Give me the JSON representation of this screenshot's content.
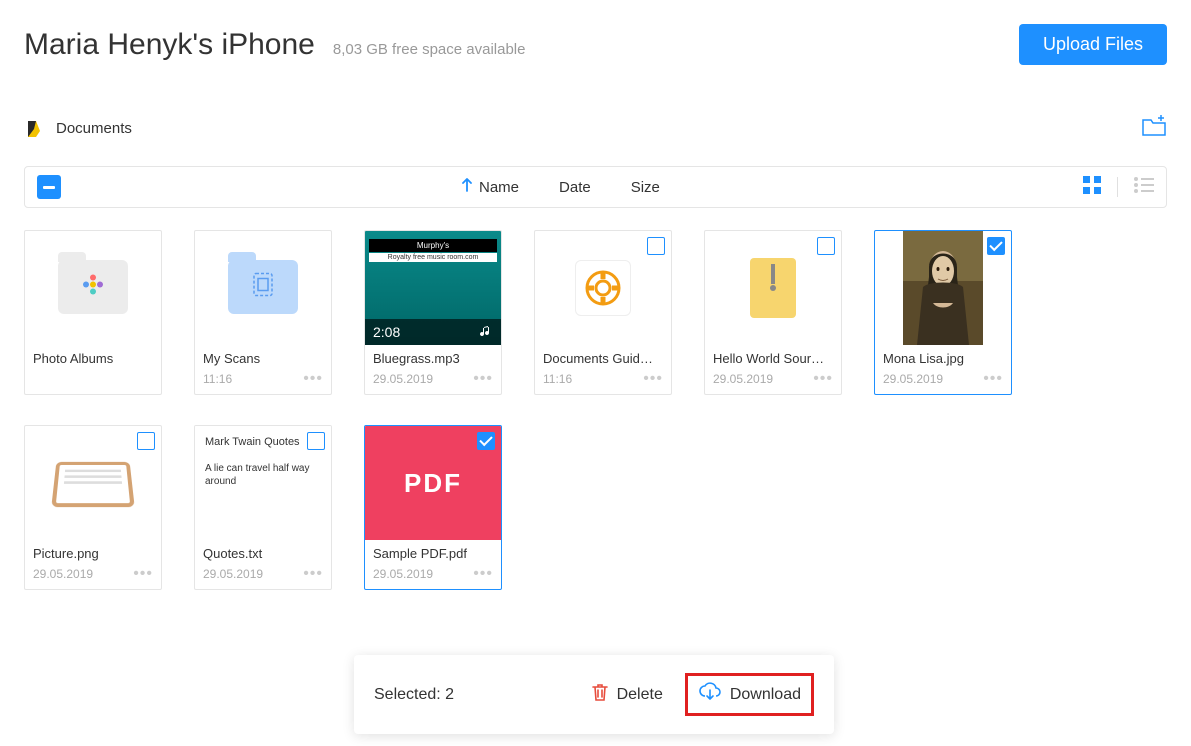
{
  "header": {
    "device_title": "Maria Henyk's iPhone",
    "free_space": "8,03 GB free space available",
    "upload_label": "Upload Files"
  },
  "breadcrumb": {
    "label": "Documents"
  },
  "toolbar": {
    "sort_columns": {
      "name": "Name",
      "date": "Date",
      "size": "Size"
    }
  },
  "files": [
    {
      "name": "Photo Albums",
      "date": "",
      "type": "folder-albums",
      "selected": false,
      "checkbox": false
    },
    {
      "name": "My Scans",
      "date": "11:16",
      "type": "folder-scans",
      "selected": false,
      "checkbox": false
    },
    {
      "name": "Bluegrass.mp3",
      "date": "29.05.2019",
      "type": "mp3",
      "selected": false,
      "checkbox": false,
      "mp3_time": "2:08",
      "mp3_b1": "Murphy's",
      "mp3_b2": "Royalty free music room.com"
    },
    {
      "name": "Documents Guid…",
      "date": "11:16",
      "type": "guide",
      "selected": false,
      "checkbox": true
    },
    {
      "name": "Hello World Sour…",
      "date": "29.05.2019",
      "type": "zip",
      "selected": false,
      "checkbox": true
    },
    {
      "name": "Mona Lisa.jpg",
      "date": "29.05.2019",
      "type": "mona",
      "selected": true,
      "checkbox": true
    },
    {
      "name": "Picture.png",
      "date": "29.05.2019",
      "type": "picture",
      "selected": false,
      "checkbox": true
    },
    {
      "name": "Quotes.txt",
      "date": "29.05.2019",
      "type": "txt",
      "selected": false,
      "checkbox": true,
      "txt_title": "Mark Twain Quotes",
      "txt_body": "A lie can travel half way around"
    },
    {
      "name": "Sample PDF.pdf",
      "date": "29.05.2019",
      "type": "pdf",
      "selected": true,
      "checkbox": true,
      "pdf_label": "PDF"
    }
  ],
  "action_bar": {
    "selected_label": "Selected: 2",
    "delete_label": "Delete",
    "download_label": "Download"
  }
}
